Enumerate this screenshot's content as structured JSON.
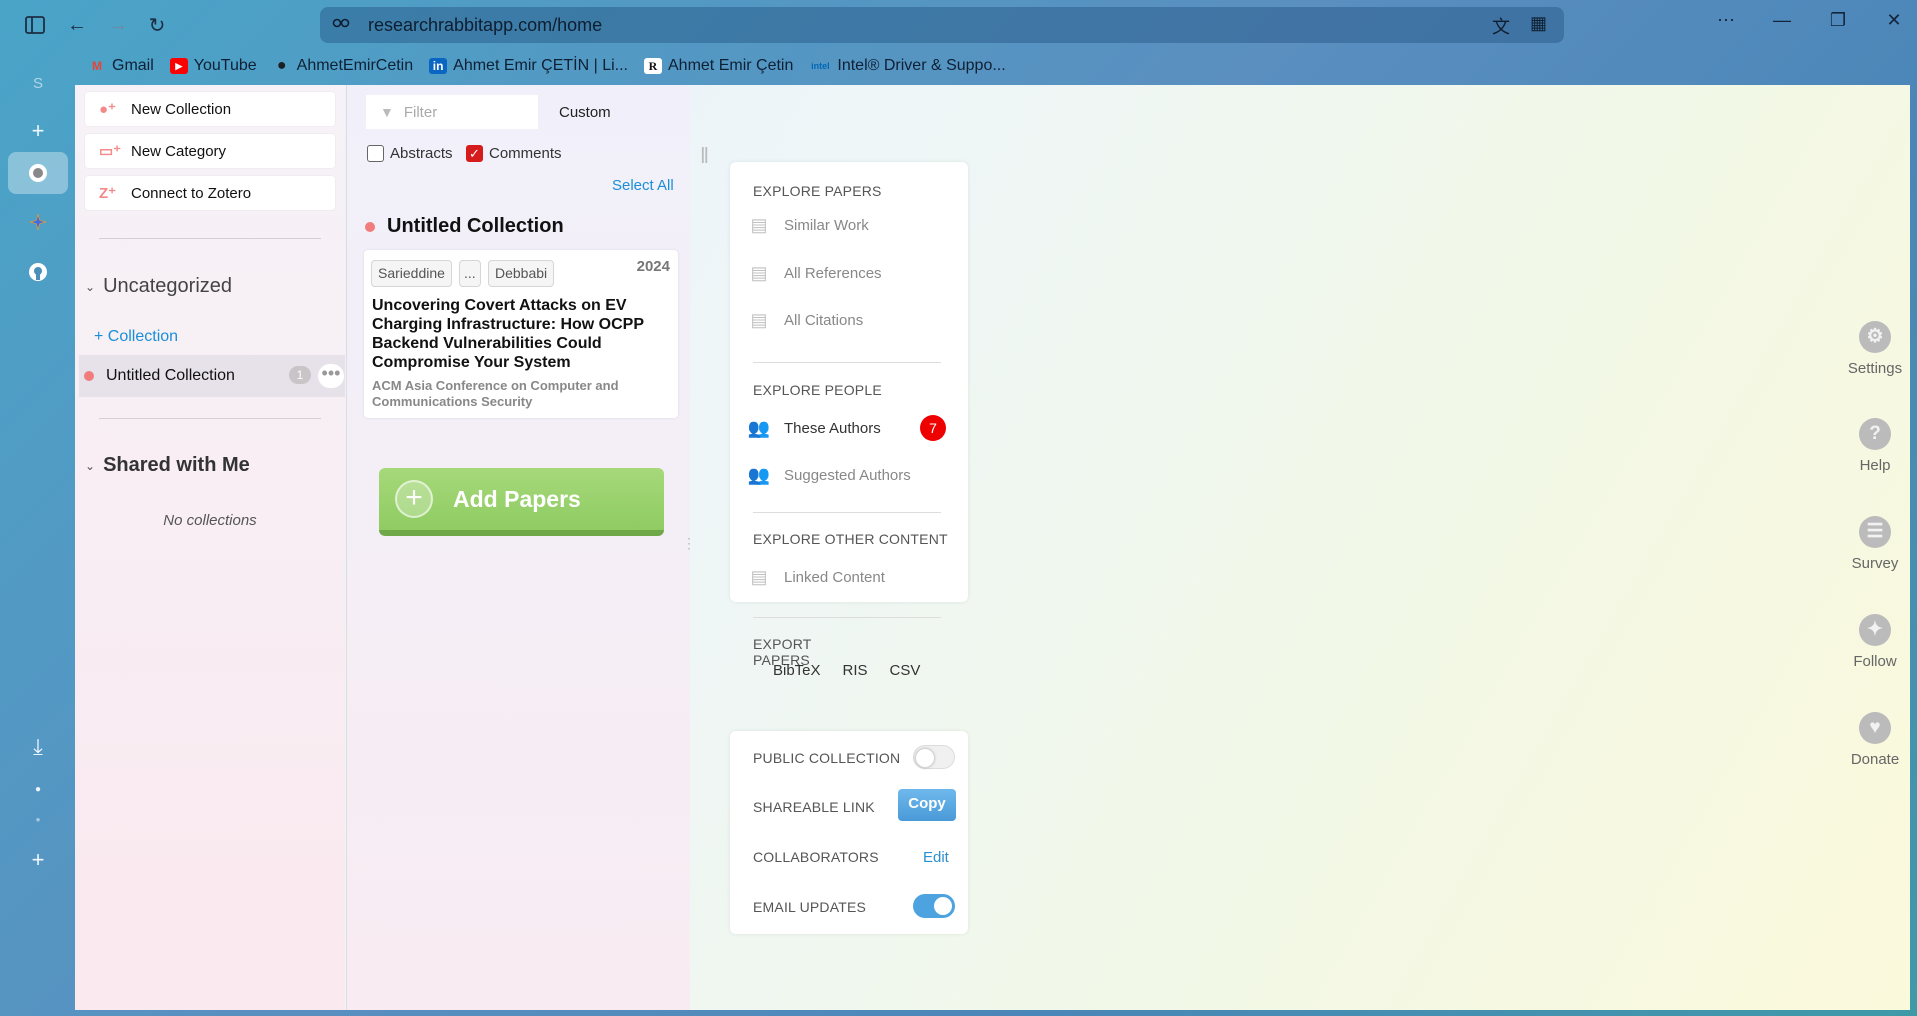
{
  "browser": {
    "url": "researchrabbitapp.com/home",
    "bookmarks": [
      {
        "label": "Gmail",
        "icon": "gmail-icon",
        "glyph": "M",
        "color": "#ea4335"
      },
      {
        "label": "YouTube",
        "icon": "youtube-icon",
        "glyph": "▶",
        "color": "#ff0000"
      },
      {
        "label": "AhmetEmirCetin",
        "icon": "github-icon",
        "glyph": "●",
        "color": "#1b1f23"
      },
      {
        "label": "Ahmet Emir ÇETİN | Li...",
        "icon": "linkedin-icon",
        "glyph": "in",
        "color": "#0a66c2"
      },
      {
        "label": "Ahmet Emir Çetin",
        "icon": "researchgate-icon",
        "glyph": "R",
        "color": "#ffffff"
      },
      {
        "label": "Intel® Driver & Suppo...",
        "icon": "intel-icon",
        "glyph": "intel",
        "color": "#0068b5"
      }
    ],
    "sidebar_initial": "S"
  },
  "col1": {
    "new_collection": "New Collection",
    "new_category": "New Category",
    "connect_zotero": "Connect to Zotero",
    "uncategorized": "Uncategorized",
    "add_collection": "+ Collection",
    "collection_name": "Untitled Collection",
    "collection_count": "1",
    "shared_with_me": "Shared with Me",
    "no_collections": "No collections"
  },
  "col2": {
    "filter_placeholder": "Filter",
    "sort_label": "Custom",
    "abstracts_label": "Abstracts",
    "comments_label": "Comments",
    "select_all": "Select All",
    "collection_title": "Untitled Collection",
    "paper": {
      "authors": [
        "Sarieddine",
        "...",
        "Debbabi"
      ],
      "year": "2024",
      "title": "Uncovering Covert Attacks on EV Charging Infrastructure: How OCPP Backend Vulnerabilities Could Compromise Your System",
      "venue": "ACM Asia Conference on Computer and Communications Security"
    },
    "add_papers": "Add Papers"
  },
  "explore": {
    "papers_header": "EXPLORE PAPERS",
    "similar_work": "Similar Work",
    "all_references": "All References",
    "all_citations": "All Citations",
    "people_header": "EXPLORE PEOPLE",
    "these_authors": "These Authors",
    "these_authors_count": "7",
    "suggested_authors": "Suggested Authors",
    "other_header": "EXPLORE OTHER CONTENT",
    "linked_content": "Linked Content",
    "export_header": "EXPORT PAPERS",
    "export_options": [
      "BibTeX",
      "RIS",
      "CSV"
    ]
  },
  "settings_panel": {
    "public_collection": "PUBLIC COLLECTION",
    "public_on": false,
    "shareable_link": "SHAREABLE LINK",
    "copy": "Copy",
    "collaborators": "COLLABORATORS",
    "edit": "Edit",
    "email_updates": "EMAIL UPDATES",
    "email_on": true
  },
  "right_nav": [
    {
      "label": "Settings",
      "icon": "gear-icon",
      "glyph": "⚙"
    },
    {
      "label": "Help",
      "icon": "help-icon",
      "glyph": "?"
    },
    {
      "label": "Survey",
      "icon": "survey-icon",
      "glyph": "☰"
    },
    {
      "label": "Follow",
      "icon": "twitter-icon",
      "glyph": "✦"
    },
    {
      "label": "Donate",
      "icon": "heart-icon",
      "glyph": "♥"
    }
  ]
}
